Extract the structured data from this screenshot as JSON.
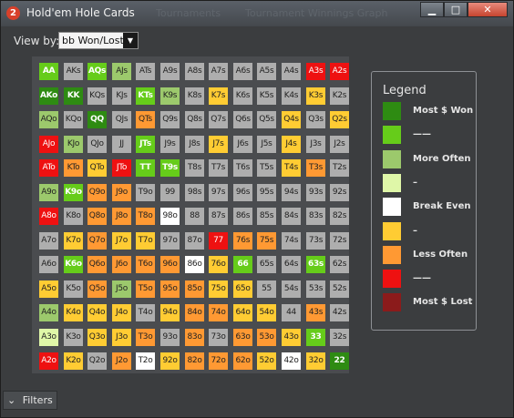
{
  "window": {
    "title": "Hold'em Hole Cards",
    "app_icon": "2",
    "ghost_tabs": [
      "Tournaments",
      "Tournament Winnings Graph"
    ]
  },
  "controls": {
    "minimize": "▁",
    "maximize": "□",
    "close": "✕"
  },
  "viewby": {
    "label": "View by:",
    "value": "bb Won/Lost"
  },
  "colors": {
    "dg": "#2e8b12",
    "lg": "#66cc1a",
    "pg": "#9cc96c",
    "vpg": "#dff7a8",
    "wh": "#ffffff",
    "ye": "#ffcc33",
    "or": "#ff9933",
    "rd": "#ee1111",
    "dr": "#8b1b1b",
    "gy": "#aeaeae"
  },
  "grid": [
    [
      [
        "AA",
        "lg"
      ],
      [
        "AKs",
        "gy"
      ],
      [
        "AQs",
        "lg"
      ],
      [
        "AJs",
        "pg"
      ],
      [
        "ATs",
        "gy"
      ],
      [
        "A9s",
        "gy"
      ],
      [
        "A8s",
        "gy"
      ],
      [
        "A7s",
        "gy"
      ],
      [
        "A6s",
        "gy"
      ],
      [
        "A5s",
        "gy"
      ],
      [
        "A4s",
        "gy"
      ],
      [
        "A3s",
        "rd"
      ],
      [
        "A2s",
        "rd"
      ]
    ],
    [
      [
        "AKo",
        "dg"
      ],
      [
        "KK",
        "dg"
      ],
      [
        "KQs",
        "gy"
      ],
      [
        "KJs",
        "gy"
      ],
      [
        "KTs",
        "lg"
      ],
      [
        "K9s",
        "pg"
      ],
      [
        "K8s",
        "gy"
      ],
      [
        "K7s",
        "ye"
      ],
      [
        "K6s",
        "gy"
      ],
      [
        "K5s",
        "gy"
      ],
      [
        "K4s",
        "gy"
      ],
      [
        "K3s",
        "ye"
      ],
      [
        "K2s",
        "gy"
      ]
    ],
    [
      [
        "AQo",
        "pg"
      ],
      [
        "KQo",
        "gy"
      ],
      [
        "QQ",
        "dg"
      ],
      [
        "QJs",
        "gy"
      ],
      [
        "QTs",
        "or"
      ],
      [
        "Q9s",
        "gy"
      ],
      [
        "Q8s",
        "gy"
      ],
      [
        "Q7s",
        "gy"
      ],
      [
        "Q6s",
        "gy"
      ],
      [
        "Q5s",
        "gy"
      ],
      [
        "Q4s",
        "ye"
      ],
      [
        "Q3s",
        "gy"
      ],
      [
        "Q2s",
        "ye"
      ]
    ],
    [
      [
        "AJo",
        "rd"
      ],
      [
        "KJo",
        "pg"
      ],
      [
        "QJo",
        "gy"
      ],
      [
        "JJ",
        "gy"
      ],
      [
        "JTs",
        "lg"
      ],
      [
        "J9s",
        "gy"
      ],
      [
        "J8s",
        "gy"
      ],
      [
        "J7s",
        "ye"
      ],
      [
        "J6s",
        "gy"
      ],
      [
        "J5s",
        "gy"
      ],
      [
        "J4s",
        "ye"
      ],
      [
        "J3s",
        "gy"
      ],
      [
        "J2s",
        "gy"
      ]
    ],
    [
      [
        "ATo",
        "rd"
      ],
      [
        "KTo",
        "or"
      ],
      [
        "QTo",
        "ye"
      ],
      [
        "JTo",
        "rd"
      ],
      [
        "TT",
        "lg"
      ],
      [
        "T9s",
        "lg"
      ],
      [
        "T8s",
        "gy"
      ],
      [
        "T7s",
        "gy"
      ],
      [
        "T6s",
        "gy"
      ],
      [
        "T5s",
        "gy"
      ],
      [
        "T4s",
        "ye"
      ],
      [
        "T3s",
        "or"
      ],
      [
        "T2s",
        "gy"
      ]
    ],
    [
      [
        "A9o",
        "pg"
      ],
      [
        "K9o",
        "lg"
      ],
      [
        "Q9o",
        "or"
      ],
      [
        "J9o",
        "or"
      ],
      [
        "T9o",
        "gy"
      ],
      [
        "99",
        "gy"
      ],
      [
        "98s",
        "gy"
      ],
      [
        "97s",
        "gy"
      ],
      [
        "96s",
        "gy"
      ],
      [
        "95s",
        "gy"
      ],
      [
        "94s",
        "gy"
      ],
      [
        "93s",
        "gy"
      ],
      [
        "92s",
        "gy"
      ]
    ],
    [
      [
        "A8o",
        "rd"
      ],
      [
        "K8o",
        "gy"
      ],
      [
        "Q8o",
        "or"
      ],
      [
        "J8o",
        "or"
      ],
      [
        "T8o",
        "or"
      ],
      [
        "98o",
        "wh"
      ],
      [
        "88",
        "gy"
      ],
      [
        "87s",
        "gy"
      ],
      [
        "86s",
        "gy"
      ],
      [
        "85s",
        "gy"
      ],
      [
        "84s",
        "gy"
      ],
      [
        "83s",
        "gy"
      ],
      [
        "82s",
        "gy"
      ]
    ],
    [
      [
        "A7o",
        "gy"
      ],
      [
        "K7o",
        "ye"
      ],
      [
        "Q7o",
        "or"
      ],
      [
        "J7o",
        "ye"
      ],
      [
        "T7o",
        "ye"
      ],
      [
        "97o",
        "gy"
      ],
      [
        "87o",
        "gy"
      ],
      [
        "77",
        "rd"
      ],
      [
        "76s",
        "or"
      ],
      [
        "75s",
        "or"
      ],
      [
        "74s",
        "gy"
      ],
      [
        "73s",
        "gy"
      ],
      [
        "72s",
        "gy"
      ]
    ],
    [
      [
        "A6o",
        "gy"
      ],
      [
        "K6o",
        "lg"
      ],
      [
        "Q6o",
        "or"
      ],
      [
        "J6o",
        "or"
      ],
      [
        "T6o",
        "or"
      ],
      [
        "96o",
        "or"
      ],
      [
        "86o",
        "wh"
      ],
      [
        "76o",
        "ye"
      ],
      [
        "66",
        "lg"
      ],
      [
        "65s",
        "gy"
      ],
      [
        "64s",
        "gy"
      ],
      [
        "63s",
        "lg"
      ],
      [
        "62s",
        "gy"
      ]
    ],
    [
      [
        "A5o",
        "ye"
      ],
      [
        "K5o",
        "gy"
      ],
      [
        "Q5o",
        "or"
      ],
      [
        "J5o",
        "pg"
      ],
      [
        "T5o",
        "or"
      ],
      [
        "95o",
        "or"
      ],
      [
        "85o",
        "or"
      ],
      [
        "75o",
        "ye"
      ],
      [
        "65o",
        "ye"
      ],
      [
        "55",
        "gy"
      ],
      [
        "54s",
        "gy"
      ],
      [
        "53s",
        "gy"
      ],
      [
        "52s",
        "gy"
      ]
    ],
    [
      [
        "A4o",
        "pg"
      ],
      [
        "K4o",
        "ye"
      ],
      [
        "Q4o",
        "ye"
      ],
      [
        "J4o",
        "ye"
      ],
      [
        "T4o",
        "gy"
      ],
      [
        "94o",
        "ye"
      ],
      [
        "84o",
        "or"
      ],
      [
        "74o",
        "or"
      ],
      [
        "64o",
        "ye"
      ],
      [
        "54o",
        "ye"
      ],
      [
        "44",
        "gy"
      ],
      [
        "43s",
        "or"
      ],
      [
        "42s",
        "gy"
      ]
    ],
    [
      [
        "A3o",
        "vpg"
      ],
      [
        "K3o",
        "gy"
      ],
      [
        "Q3o",
        "ye"
      ],
      [
        "J3o",
        "ye"
      ],
      [
        "T3o",
        "or"
      ],
      [
        "93o",
        "gy"
      ],
      [
        "83o",
        "or"
      ],
      [
        "73o",
        "gy"
      ],
      [
        "63o",
        "or"
      ],
      [
        "53o",
        "or"
      ],
      [
        "43o",
        "ye"
      ],
      [
        "33",
        "lg"
      ],
      [
        "32s",
        "gy"
      ]
    ],
    [
      [
        "A2o",
        "rd"
      ],
      [
        "K2o",
        "ye"
      ],
      [
        "Q2o",
        "gy"
      ],
      [
        "J2o",
        "or"
      ],
      [
        "T2o",
        "wh"
      ],
      [
        "92o",
        "ye"
      ],
      [
        "82o",
        "or"
      ],
      [
        "72o",
        "or"
      ],
      [
        "62o",
        "or"
      ],
      [
        "52o",
        "ye"
      ],
      [
        "42o",
        "wh"
      ],
      [
        "32o",
        "ye"
      ],
      [
        "22",
        "dg"
      ]
    ]
  ],
  "legend": {
    "title": "Legend",
    "items": [
      {
        "color": "dg",
        "label": "Most $ Won"
      },
      {
        "color": "lg",
        "label": "——"
      },
      {
        "color": "pg",
        "label": "More Often"
      },
      {
        "color": "vpg",
        "label": "–"
      },
      {
        "color": "wh",
        "label": "Break Even"
      },
      {
        "color": "ye",
        "label": "–"
      },
      {
        "color": "or",
        "label": "Less Often"
      },
      {
        "color": "rd",
        "label": "——"
      },
      {
        "color": "dr",
        "label": "Most $ Lost"
      }
    ]
  },
  "filters": {
    "label": "Filters",
    "chevron": "⌄"
  }
}
